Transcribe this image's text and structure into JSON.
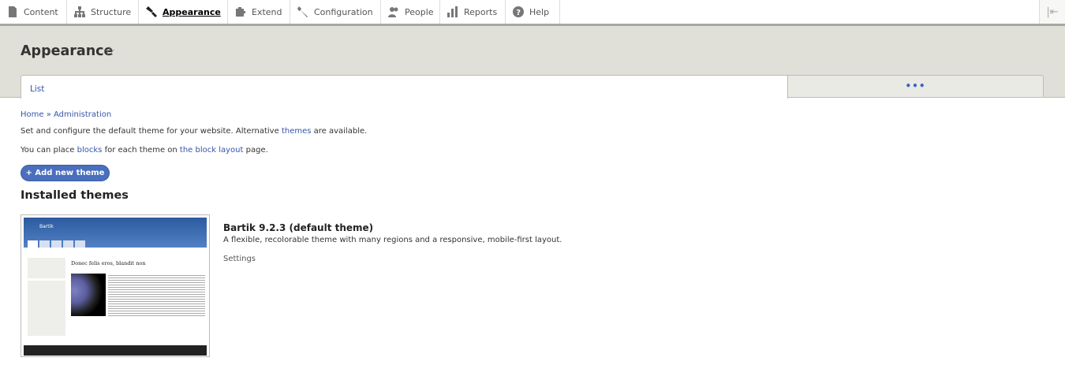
{
  "toolbar": {
    "items": [
      {
        "label": "Content",
        "icon": "file-icon"
      },
      {
        "label": "Structure",
        "icon": "sitemap-icon"
      },
      {
        "label": "Appearance",
        "icon": "paintbrush-icon"
      },
      {
        "label": "Extend",
        "icon": "puzzle-icon"
      },
      {
        "label": "Configuration",
        "icon": "wrench-icon"
      },
      {
        "label": "People",
        "icon": "people-icon"
      },
      {
        "label": "Reports",
        "icon": "bar-chart-icon"
      },
      {
        "label": "Help",
        "icon": "help-icon"
      }
    ],
    "collapse": "|⇤"
  },
  "header": {
    "title": "Appearance",
    "star": "☆",
    "tabs": {
      "list": "List",
      "more": "•••"
    }
  },
  "breadcrumb": {
    "home": "Home",
    "sep": " » ",
    "admin": "Administration"
  },
  "intro": {
    "p1_a": "Set and configure the default theme for your website. Alternative ",
    "p1_link": "themes",
    "p1_b": " are available.",
    "p2_a": "You can place ",
    "p2_link1": "blocks",
    "p2_b": " for each theme on ",
    "p2_link2": "the block layout",
    "p2_c": " page."
  },
  "add_button": "+ Add new theme",
  "installed_heading": "Installed themes",
  "themes": [
    {
      "name": "Bartik 9.2.3 (default theme)",
      "description": "A flexible, recolorable theme with many regions and a responsive, mobile-first layout.",
      "settings": "Settings",
      "screenshot": {
        "site_name": "Bartik",
        "article_title": "Donec felis eros, blandit non"
      }
    }
  ]
}
